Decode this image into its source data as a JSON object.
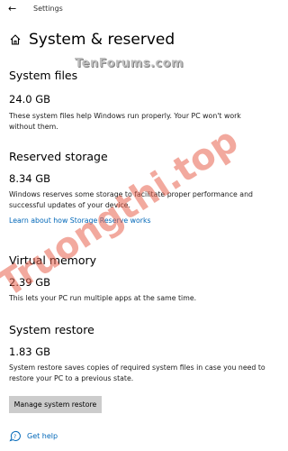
{
  "window": {
    "back_icon": "back-arrow-icon",
    "title": "Settings"
  },
  "page": {
    "home_icon": "home-icon",
    "title": "System & reserved"
  },
  "watermarks": {
    "top": "TenForums.com",
    "diagonal": "Truongthi.top"
  },
  "sections": [
    {
      "heading": "System files",
      "size": "24.0 GB",
      "desc_line1": "These system files help Windows run properly. Your PC won't work",
      "desc_line2": "without them."
    },
    {
      "heading": "Reserved storage",
      "size": "8.34 GB",
      "desc_line1": "Windows reserves some storage to facilitate proper performance and",
      "desc_line2": "successful updates of your device.",
      "link": "Learn about how Storage Reserve works"
    },
    {
      "heading": "Virtual memory",
      "size": "2.39 GB",
      "desc_line1": "This lets your PC run multiple apps at the same time."
    },
    {
      "heading": "System restore",
      "size": "1.83 GB",
      "desc_line1": "System restore saves copies of required system files in case you need to",
      "desc_line2": "restore your PC to a previous state.",
      "button": "Manage system restore"
    }
  ],
  "footer": {
    "help_icon": "help-icon",
    "help_label": "Get help"
  },
  "colors": {
    "link": "#0067b8",
    "button_bg": "#cccccc",
    "watermark_diag": "#e8634f"
  }
}
